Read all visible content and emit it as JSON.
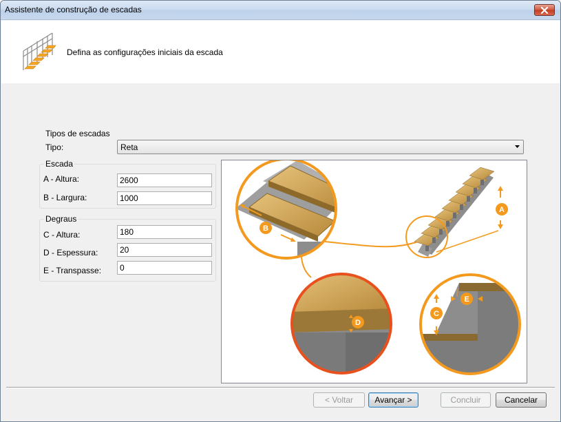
{
  "window": {
    "title": "Assistente de construção de escadas"
  },
  "header": {
    "text": "Defina as configurações iniciais da escada",
    "icon": "stairs-icon"
  },
  "tipos": {
    "group_label": "Tipos de escadas",
    "tipo_label": "Tipo:",
    "tipo_value": "Reta"
  },
  "escada": {
    "group_label": "Escada",
    "altura_label": "A - Altura:",
    "altura_value": "2600",
    "largura_label": "B - Largura:",
    "largura_value": "1000"
  },
  "degraus": {
    "group_label": "Degraus",
    "altura_label": "C - Altura:",
    "altura_value": "180",
    "espessura_label": "D - Espessura:",
    "espessura_value": "20",
    "transpasse_label": "E - Transpasse:",
    "transpasse_value": "0"
  },
  "illustration": {
    "labels": {
      "a": "A",
      "b": "B",
      "c": "C",
      "d": "D",
      "e": "E"
    },
    "accent_color": "#f39a1e"
  },
  "buttons": {
    "back": "< Voltar",
    "next": "Avançar >",
    "finish": "Concluir",
    "cancel": "Cancelar"
  }
}
